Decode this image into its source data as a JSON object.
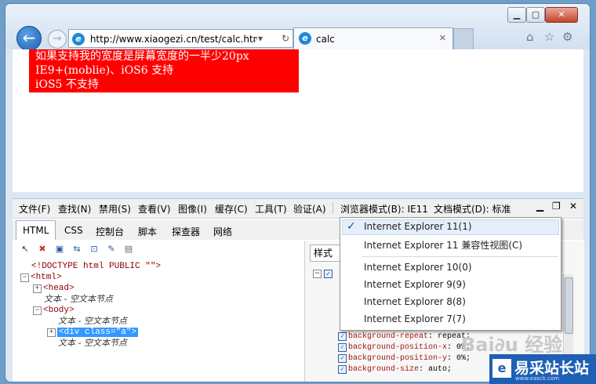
{
  "browser": {
    "address": "http://www.xiaogezi.cn/test/calc.htr",
    "tab_title": "calc",
    "tab_close": "✕"
  },
  "page": {
    "lines": [
      "如果支持我的宽度是屏幕宽度的一半少20px",
      "IE9+(moblie)、iOS6 支持",
      "iOS5 不支持"
    ]
  },
  "devtools": {
    "menu": [
      {
        "label": "文件(F)"
      },
      {
        "label": "查找(N)"
      },
      {
        "label": "禁用(S)"
      },
      {
        "label": "查看(V)"
      },
      {
        "label": "图像(I)"
      },
      {
        "label": "缓存(C)"
      },
      {
        "label": "工具(T)"
      },
      {
        "label": "验证(A)"
      },
      {
        "label": "浏览器模式(B): IE11"
      },
      {
        "label": "文档模式(D): 标准"
      }
    ],
    "tabs": [
      {
        "label": "HTML"
      },
      {
        "label": "CSS"
      },
      {
        "label": "控制台"
      },
      {
        "label": "脚本"
      },
      {
        "label": "探查器"
      },
      {
        "label": "网络"
      }
    ],
    "tree": [
      {
        "text": "<!DOCTYPE html PUBLIC \"\">"
      },
      {
        "text": "<html>"
      },
      {
        "text": "<head>"
      },
      {
        "text": "文本 - 空文本节点"
      },
      {
        "text": "<body>"
      },
      {
        "text": "文本 - 空文本节点"
      },
      {
        "text": "<div class=\"a\">"
      },
      {
        "text": "文本 - 空文本节点"
      }
    ],
    "style_panel_label": "样式",
    "properties": [
      {
        "name": "background-repeat",
        "value": "repeat;"
      },
      {
        "name": "background-position-x",
        "value": "0%;"
      },
      {
        "name": "background-position-y",
        "value": "0%;"
      },
      {
        "name": "background-size",
        "value": "auto;"
      }
    ]
  },
  "dropdown": {
    "items": [
      {
        "label": "Internet Explorer 11(1)",
        "checked": true
      },
      {
        "label": "Internet Explorer 11 兼容性视图(C)",
        "checked": false
      },
      {
        "label": "Internet Explorer 10(0)",
        "checked": false
      },
      {
        "label": "Internet Explorer 9(9)",
        "checked": false
      },
      {
        "label": "Internet Explorer 8(8)",
        "checked": false
      },
      {
        "label": "Internet Explorer 7(7)",
        "checked": false
      }
    ]
  },
  "watermark": {
    "logo_text": "易采站长站",
    "logo_sub": "www.easck.com"
  }
}
